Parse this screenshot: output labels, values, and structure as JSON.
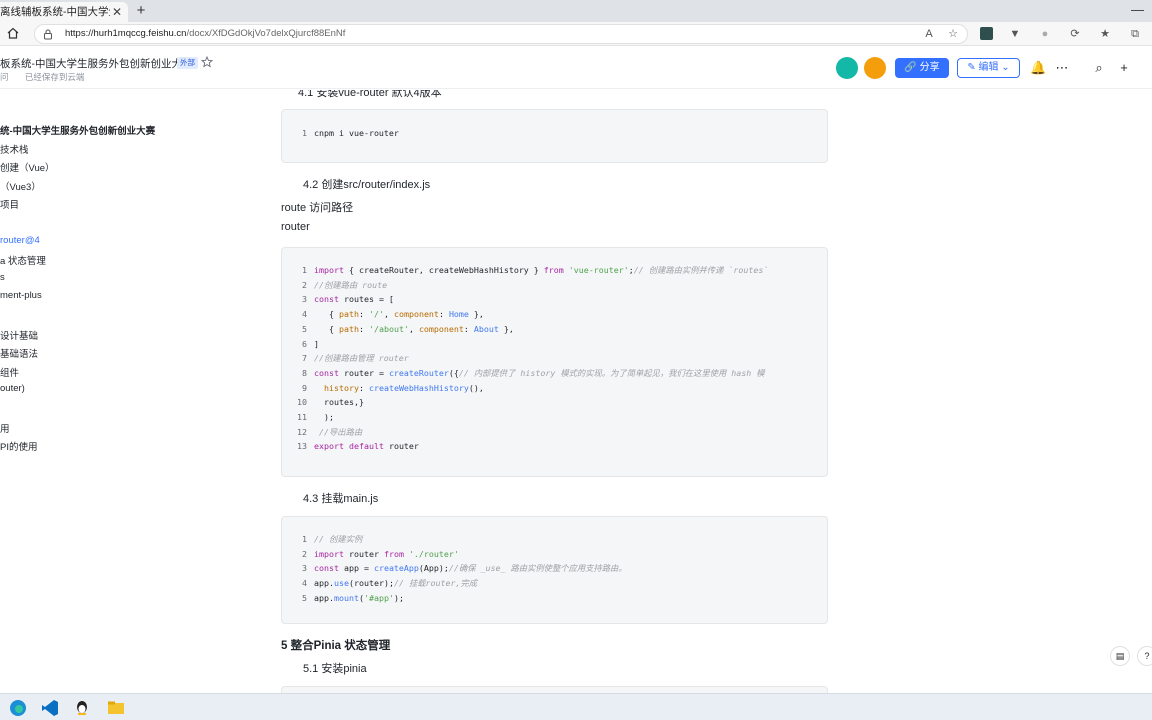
{
  "browser": {
    "tab_title": "离线辅板系统-中国大学生服务外",
    "tab_close": "✕",
    "new_tab": "+",
    "url_host": "https://hurh1mqccg.feishu.cn",
    "url_path": "/docx/XfDGdOkjVo7delxQjurcf88EnNf",
    "minimize": "—"
  },
  "header": {
    "doc_title": "板系统-中国大学生服务外包创新创业大赛",
    "badge": "外部",
    "sub_info": "问",
    "saved": "已经保存到云端",
    "share_label": "分享",
    "edit_label": "编辑",
    "share_color": "#3370ff"
  },
  "outline": {
    "items": [
      {
        "label": "统-中国大学生服务外包创新创业大赛",
        "bold": true,
        "active": false
      },
      {
        "label": "技术栈",
        "bold": false,
        "active": false
      },
      {
        "label": "创建（Vue）",
        "bold": false,
        "active": false
      },
      {
        "label": "（Vue3）",
        "bold": false,
        "active": false
      },
      {
        "label": "项目",
        "bold": false,
        "active": false
      },
      {
        "label": "",
        "bold": false,
        "active": false
      },
      {
        "label": "router@4",
        "bold": false,
        "active": true
      },
      {
        "label": "a 状态管理",
        "bold": false,
        "active": false
      },
      {
        "label": "s",
        "bold": false,
        "active": false
      },
      {
        "label": "ment-plus",
        "bold": false,
        "active": false
      },
      {
        "label": "",
        "bold": false,
        "active": false
      },
      {
        "label": "设计基础",
        "bold": false,
        "active": false
      },
      {
        "label": "基础语法",
        "bold": false,
        "active": false
      },
      {
        "label": "组件",
        "bold": false,
        "active": false
      },
      {
        "label": "outer)",
        "bold": false,
        "active": false
      },
      {
        "label": "",
        "bold": false,
        "active": false
      },
      {
        "label": "用",
        "bold": false,
        "active": false
      },
      {
        "label": "PI的使用",
        "bold": false,
        "active": false
      }
    ]
  },
  "content": {
    "cut_heading": "4.1 安装vue-router 默认4版本",
    "code1": [
      "cnpm i vue-router"
    ],
    "h_4_2": "4.2 创建src/router/index.js",
    "p_route": "route 访问路径",
    "p_router": "router",
    "code2": [
      "import { createRouter, createWebHashHistory } from 'vue-router';// 创建路由实例并传递 `routes`",
      "//创建路由 route",
      "const routes = [",
      "   { path: '/', component: Home },",
      "   { path: '/about', component: About },",
      "]",
      "//创建路由管理 router",
      "const router = createRouter({// 内部提供了 history 模式的实现。为了简单起见，我们在这里使用 hash 模",
      "  history: createWebHashHistory(),",
      "  routes,}",
      "  );",
      " //导出路由",
      "export default router"
    ],
    "h_4_3": "4.3 挂载main.js",
    "code3": [
      "// 创建实例",
      "import router from './router'",
      "const app = createApp(App);//确保 _use_ 路由实例使整个应用支持路由。",
      "app.use(router);// 挂载router,完成",
      "app.mount('#app');"
    ],
    "h2_5": "5 整合Pinia 状态管理",
    "h_5_1": "5.1 安装pinia"
  }
}
